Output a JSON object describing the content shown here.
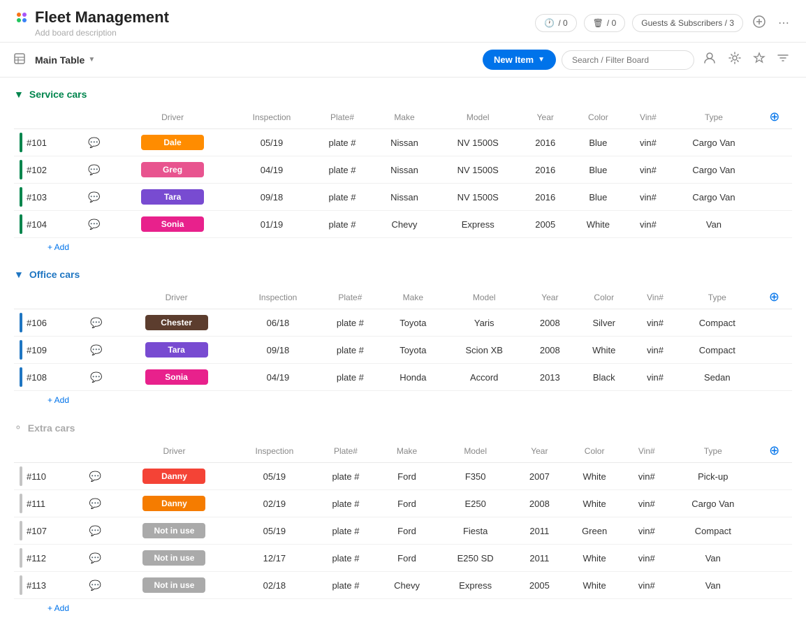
{
  "app": {
    "title": "Fleet Management",
    "subtitle": "Add board description"
  },
  "topbar": {
    "activity_count": "0",
    "inbox_count": "0",
    "guests_label": "Guests & Subscribers / 3",
    "invite_icon": "person-plus",
    "more_icon": "ellipsis"
  },
  "toolbar": {
    "table_label": "Main Table",
    "new_item_label": "New Item",
    "search_placeholder": "Search / Filter Board"
  },
  "groups": [
    {
      "id": "service-cars",
      "title": "Service cars",
      "color": "green",
      "status": "open",
      "columns": [
        "Driver",
        "Inspection",
        "Plate#",
        "Make",
        "Model",
        "Year",
        "Color",
        "Vin#",
        "Type"
      ],
      "rows": [
        {
          "id": "#101",
          "driver": "Dale",
          "driver_color": "orange",
          "inspection": "05/19",
          "plate": "plate #",
          "make": "Nissan",
          "model": "NV 1500S",
          "year": "2016",
          "color": "Blue",
          "vin": "vin#",
          "type": "Cargo Van"
        },
        {
          "id": "#102",
          "driver": "Greg",
          "driver_color": "pink",
          "inspection": "04/19",
          "plate": "plate #",
          "make": "Nissan",
          "model": "NV 1500S",
          "year": "2016",
          "color": "Blue",
          "vin": "vin#",
          "type": "Cargo Van"
        },
        {
          "id": "#103",
          "driver": "Tara",
          "driver_color": "purple",
          "inspection": "09/18",
          "plate": "plate #",
          "make": "Nissan",
          "model": "NV 1500S",
          "year": "2016",
          "color": "Blue",
          "vin": "vin#",
          "type": "Cargo Van"
        },
        {
          "id": "#104",
          "driver": "Sonia",
          "driver_color": "magenta",
          "inspection": "01/19",
          "plate": "plate #",
          "make": "Chevy",
          "model": "Express",
          "year": "2005",
          "color": "White",
          "vin": "vin#",
          "type": "Van"
        }
      ],
      "add_label": "+ Add"
    },
    {
      "id": "office-cars",
      "title": "Office cars",
      "color": "blue",
      "status": "open",
      "columns": [
        "Driver",
        "Inspection",
        "Plate#",
        "Make",
        "Model",
        "Year",
        "Color",
        "Vin#",
        "Type"
      ],
      "rows": [
        {
          "id": "#106",
          "driver": "Chester",
          "driver_color": "brown",
          "inspection": "06/18",
          "plate": "plate #",
          "make": "Toyota",
          "model": "Yaris",
          "year": "2008",
          "color": "Silver",
          "vin": "vin#",
          "type": "Compact"
        },
        {
          "id": "#109",
          "driver": "Tara",
          "driver_color": "purple",
          "inspection": "09/18",
          "plate": "plate #",
          "make": "Toyota",
          "model": "Scion XB",
          "year": "2008",
          "color": "White",
          "vin": "vin#",
          "type": "Compact"
        },
        {
          "id": "#108",
          "driver": "Sonia",
          "driver_color": "magenta",
          "inspection": "04/19",
          "plate": "plate #",
          "make": "Honda",
          "model": "Accord",
          "year": "2013",
          "color": "Black",
          "vin": "vin#",
          "type": "Sedan"
        }
      ],
      "add_label": "+ Add"
    },
    {
      "id": "extra-cars",
      "title": "Extra cars",
      "color": "gray",
      "status": "closed",
      "columns": [
        "Driver",
        "Inspection",
        "Plate#",
        "Make",
        "Model",
        "Year",
        "Color",
        "Vin#",
        "Type"
      ],
      "rows": [
        {
          "id": "#110",
          "driver": "Danny",
          "driver_color": "red-orange",
          "inspection": "05/19",
          "plate": "plate #",
          "make": "Ford",
          "model": "F350",
          "year": "2007",
          "color": "White",
          "vin": "vin#",
          "type": "Pick-up"
        },
        {
          "id": "#111",
          "driver": "Danny",
          "driver_color": "orange2",
          "inspection": "02/19",
          "plate": "plate #",
          "make": "Ford",
          "model": "E250",
          "year": "2008",
          "color": "White",
          "vin": "vin#",
          "type": "Cargo Van"
        },
        {
          "id": "#107",
          "driver": "Not in use",
          "driver_color": "gray",
          "inspection": "05/19",
          "plate": "plate #",
          "make": "Ford",
          "model": "Fiesta",
          "year": "2011",
          "color": "Green",
          "vin": "vin#",
          "type": "Compact"
        },
        {
          "id": "#112",
          "driver": "Not in use",
          "driver_color": "gray",
          "inspection": "12/17",
          "plate": "plate #",
          "make": "Ford",
          "model": "E250 SD",
          "year": "2011",
          "color": "White",
          "vin": "vin#",
          "type": "Van"
        },
        {
          "id": "#113",
          "driver": "Not in use",
          "driver_color": "gray",
          "inspection": "02/18",
          "plate": "plate #",
          "make": "Chevy",
          "model": "Express",
          "year": "2005",
          "color": "White",
          "vin": "vin#",
          "type": "Van"
        }
      ],
      "add_label": "+ Add"
    }
  ]
}
